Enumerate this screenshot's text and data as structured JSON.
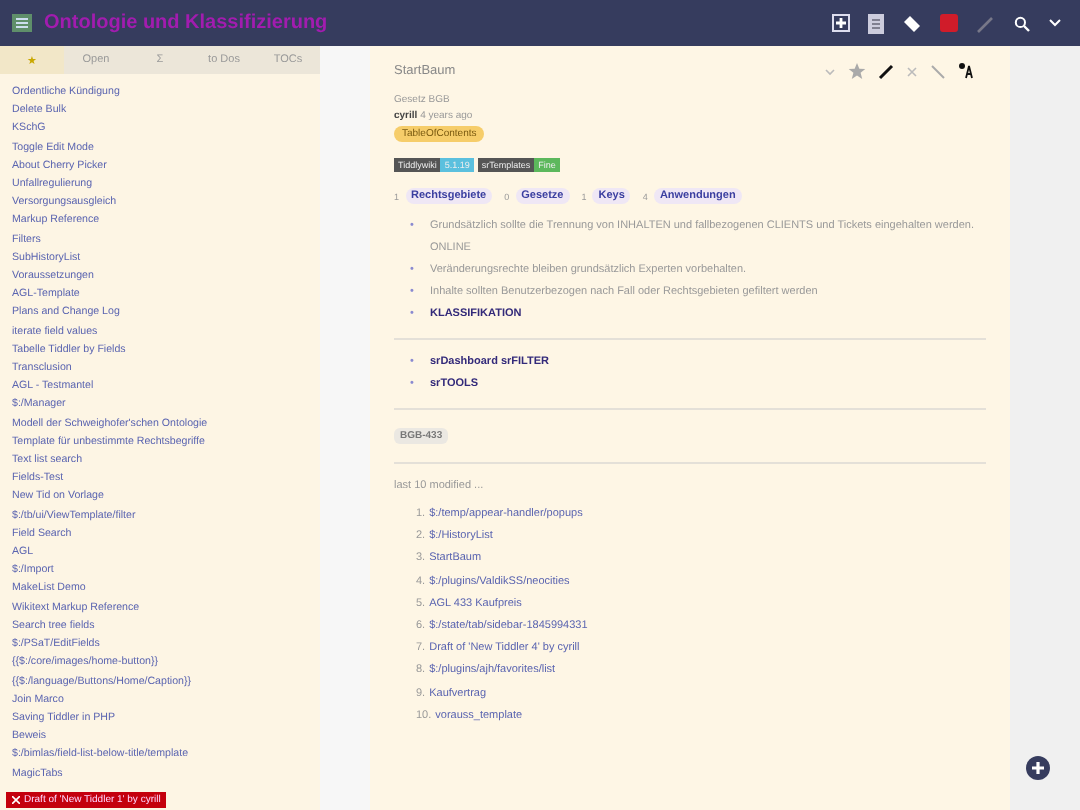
{
  "header": {
    "title": "Ontologie und Klassifizierung"
  },
  "sidebar": {
    "tabs": [
      {
        "label": "★",
        "selected": true
      },
      {
        "label": "Open",
        "selected": false
      },
      {
        "label": "Σ",
        "selected": false
      },
      {
        "label": "to Dos",
        "selected": false
      },
      {
        "label": "TOCs",
        "selected": false
      }
    ],
    "items": [
      "Ordentliche Kündigung",
      "Delete Bulk",
      "KSchG",
      "Toggle Edit Mode",
      "About Cherry Picker",
      "Unfallregulierung",
      "Versorgungsausgleich",
      "Markup Reference",
      "Filters",
      "SubHistoryList",
      "Voraussetzungen",
      "AGL-Template",
      "Plans and Change Log",
      "iterate field values",
      "Tabelle Tiddler by Fields",
      "Transclusion",
      "AGL - Testmantel",
      "$:/Manager",
      "Modell der Schweighofer'schen Ontologie",
      "Template für unbestimmte Rechtsbegriffe",
      "Text list search",
      "Fields-Test",
      "New Tid on Vorlage",
      "$:/tb/ui/ViewTemplate/filter",
      "Field Search",
      "AGL",
      "$:/Import",
      "MakeList Demo",
      "Wikitext Markup Reference",
      "Search tree fields",
      "$:/PSaT/EditFields",
      "{{$:/core/images/home-button}}",
      "{{$:/language/Buttons/Home/Caption}}",
      "Join Marco",
      "Saving Tiddler in PHP",
      "Beweis",
      "$:/bimlas/field-list-below-title/template",
      "MagicTabs"
    ],
    "draft_badge": "Draft of 'New Tiddler 1' by cyrill"
  },
  "tiddler": {
    "title": "StartBaum",
    "subtitle": "Gesetz BGB",
    "author": "cyrill",
    "age": "4 years ago",
    "tag": "TableOfContents",
    "badges": [
      {
        "label": "Tiddlywiki",
        "value": "5.1.19",
        "color": "#5bc0de"
      },
      {
        "label": "srTemplates",
        "value": "Fine",
        "color": "#5cb85c"
      }
    ],
    "counts": [
      {
        "count": "1",
        "label": "Rechtsgebiete"
      },
      {
        "count": "0",
        "label": "Gesetze"
      },
      {
        "count": "1",
        "label": "Keys"
      },
      {
        "count": "4",
        "label": "Anwendungen"
      }
    ],
    "bullets": [
      {
        "marker": "•",
        "text": "Grundsätzlich sollte die Trennung von INHALTEN und fallbezogenen CLIENTS und Tickets eingehalten werden. ONLINE",
        "kind": "plain"
      },
      {
        "marker": "•",
        "text": "Veränderungsrechte bleiben grundsätzlich Experten vorbehalten.",
        "kind": "plain"
      },
      {
        "marker": "•",
        "text": "Inhalte sollten Benutzerbezogen nach Fall oder Rechtsgebieten gefiltert werden",
        "kind": "plain"
      },
      {
        "marker": "•",
        "text": "KLASSIFIKATION",
        "kind": "link"
      }
    ],
    "links": [
      {
        "marker": "•",
        "text": "srDashboard srFILTER"
      },
      {
        "marker": "•",
        "text": "srTOOLS"
      }
    ],
    "tag2": "BGB-433",
    "recent_heading": "last 10 modified ...",
    "recent": [
      {
        "n": "1.",
        "t": "$:/temp/appear-handler/popups"
      },
      {
        "n": "2.",
        "t": "$:/HistoryList"
      },
      {
        "n": "3.",
        "t": "StartBaum"
      },
      {
        "n": "4.",
        "t": "$:/plugins/ValdikSS/neocities"
      },
      {
        "n": "5.",
        "t": "AGL 433 Kaufpreis"
      },
      {
        "n": "6.",
        "t": "$:/state/tab/sidebar-1845994331"
      },
      {
        "n": "7.",
        "t": "Draft of 'New Tiddler 4' by cyrill"
      },
      {
        "n": "8.",
        "t": "$:/plugins/ajh/favorites/list"
      },
      {
        "n": "9.",
        "t": "Kaufvertrag"
      },
      {
        "n": "10.",
        "t": "vorauss_template"
      }
    ]
  }
}
